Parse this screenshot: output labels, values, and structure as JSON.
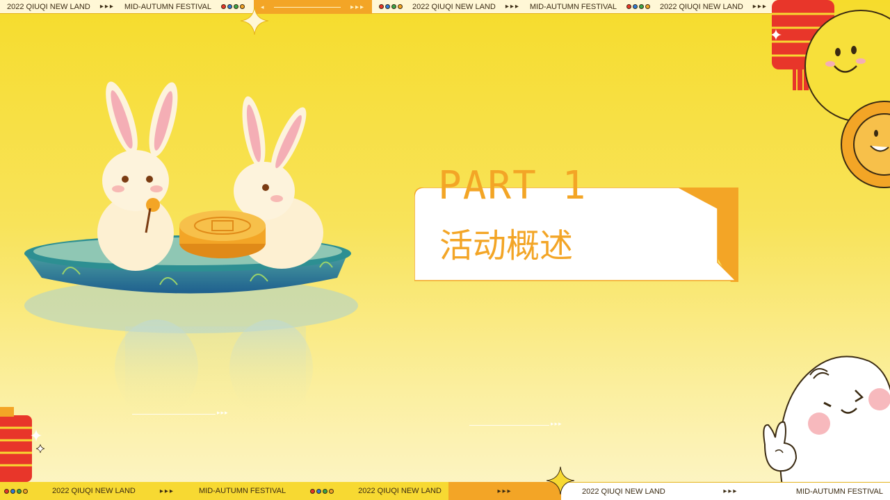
{
  "ribbon_top": {
    "text_land": "2022 QIUQI NEW LAND",
    "text_festival": "MID-AUTUMN FESTIVAL",
    "arrows": "▸▸▸",
    "line_arrows": "▸▸▸"
  },
  "ribbon_bottom": {
    "text_land": "2022 QIUQI NEW LAND",
    "text_festival": "MID-AUTUMN FESTIVAL",
    "arrows": "▸▸▸"
  },
  "slide": {
    "part_title": "PART 1",
    "section_title": "活动概述"
  },
  "icons": {
    "rabbits": "rabbits-on-boat-icon",
    "moon": "smiling-moon-icon",
    "lantern": "lantern-icon",
    "ghost": "ghost-icon",
    "sparkle": "sparkle-icon"
  },
  "colors": {
    "background": "#f6dc2c",
    "accent_orange": "#f3a526",
    "card_white": "#ffffff",
    "lantern_red": "#e8362a"
  }
}
